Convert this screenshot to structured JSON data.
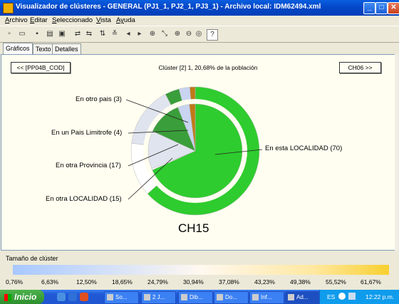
{
  "window": {
    "title": "Visualizador de clústeres - GENERAL (PJ1_1, PJ2_1, PJ3_1) - Archivo local: IDM62494.xml",
    "min": "_",
    "max": "□",
    "close": "✕"
  },
  "menu": [
    {
      "accel": "A",
      "rest": "rchivo"
    },
    {
      "accel": "E",
      "rest": "ditar"
    },
    {
      "accel": "S",
      "rest": "eleccionado"
    },
    {
      "accel": "V",
      "rest": "ista"
    },
    {
      "accel": "Ay",
      "rest": "uda"
    }
  ],
  "tabs": [
    "Gráficos",
    "Texto",
    "Detalles"
  ],
  "nav": {
    "prev": "<< [PP04B_COD]",
    "next": "CH06 >>"
  },
  "cluster_title": "Clúster [2] 1, 20,68% de la población",
  "chart_data": {
    "type": "pie",
    "title": "CH15",
    "categories": [
      "En esta LOCALIDAD (70)",
      "En otra LOCALIDAD (15)",
      "En otra Provincia (17)",
      "En un Pais Limitrofe (4)",
      "En otro pais (3)",
      "(sin rótulo)"
    ],
    "inner_values": [
      68,
      0.5,
      13,
      12,
      4,
      2
    ],
    "outer_values": [
      70,
      15,
      17,
      4,
      3,
      1.5
    ],
    "colors": [
      "#2ecc2e",
      "#ffffff",
      "#e0e4ee",
      "#3a9e3a",
      "#c8d4f0",
      "#c07818"
    ]
  },
  "legend": {
    "title": "Tamaño de clúster",
    "ticks": [
      "0,76%",
      "6,63%",
      "12,50%",
      "18,65%",
      "24,79%",
      "30,94%",
      "37,08%",
      "43,23%",
      "49,38%",
      "55,52%",
      "61,67%"
    ]
  },
  "taskbar": {
    "start": "Inicio",
    "tasks": [
      "So...",
      "2 J...",
      "Dib...",
      "Do...",
      "Inf...",
      "Ad..."
    ],
    "lang": "ES",
    "clock": "12:22 p.m."
  }
}
